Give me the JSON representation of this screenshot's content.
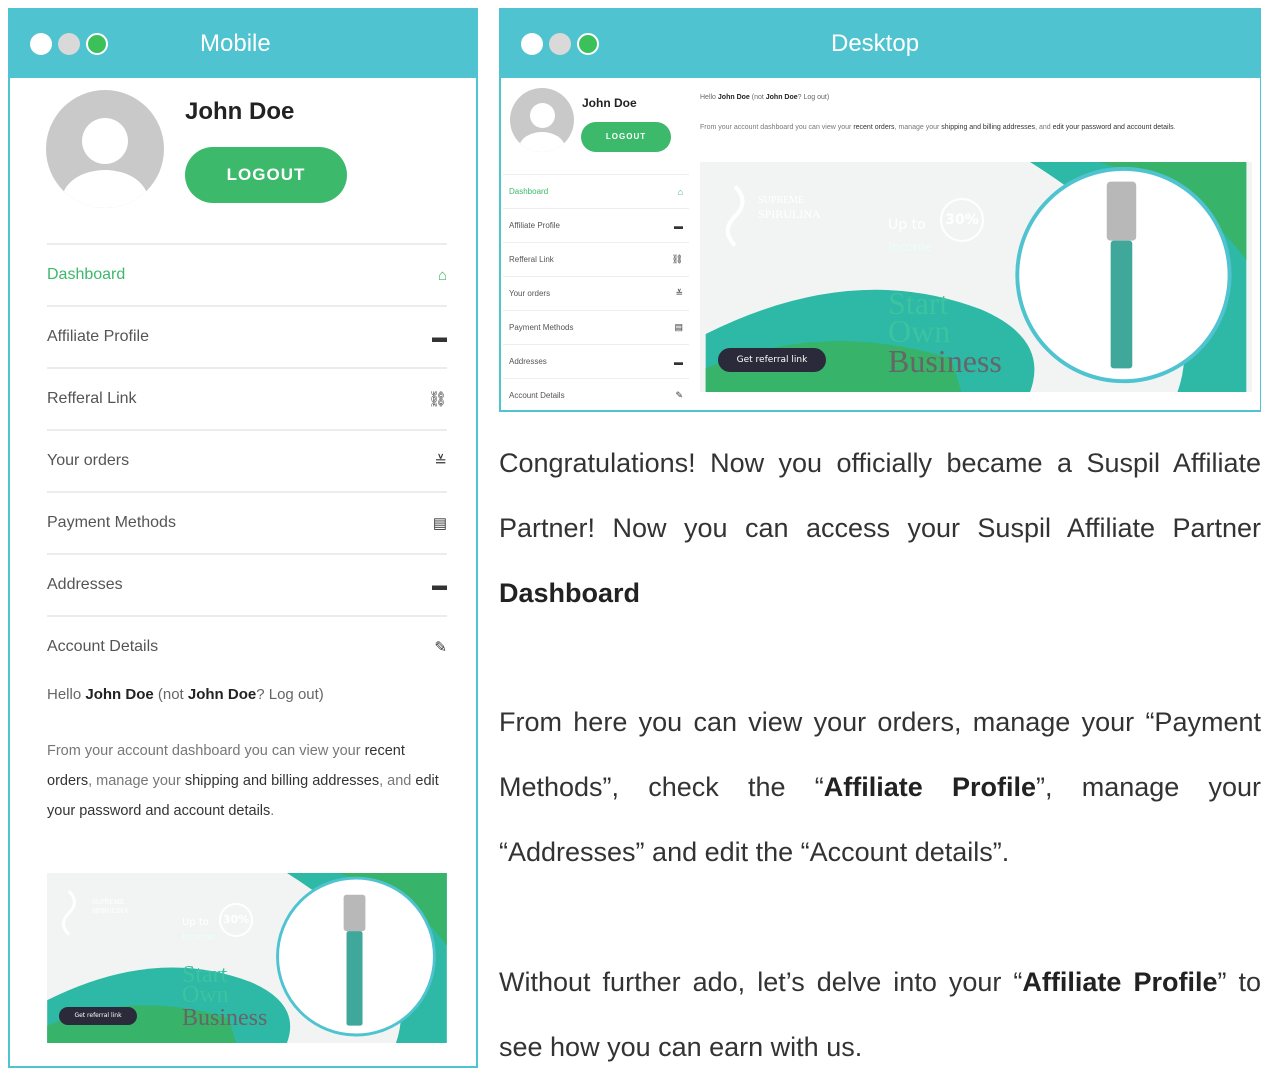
{
  "mobile": {
    "title": "Mobile",
    "user_name": "John Doe",
    "logout_label": "LOGOUT",
    "nav": [
      {
        "label": "Dashboard",
        "icon": "home-icon",
        "glyph": "⌂",
        "active": true
      },
      {
        "label": "Affiliate Profile",
        "icon": "id-card-icon",
        "glyph": "▬",
        "active": false
      },
      {
        "label": "Refferal Link",
        "icon": "link-icon",
        "glyph": "⛓",
        "active": false
      },
      {
        "label": "Your orders",
        "icon": "orders-icon",
        "glyph": "≚",
        "active": false
      },
      {
        "label": "Payment Methods",
        "icon": "credit-card-icon",
        "glyph": "▤",
        "active": false
      },
      {
        "label": "Addresses",
        "icon": "address-card-icon",
        "glyph": "▬",
        "active": false
      },
      {
        "label": "Account Details",
        "icon": "edit-icon",
        "glyph": "✎",
        "active": false
      }
    ],
    "hello": {
      "prefix": "Hello ",
      "name": "John Doe",
      "middle": " (not ",
      "name2": "John Doe",
      "suffix": "? Log out)"
    },
    "info": {
      "t1": "From your account dashboard you can view your ",
      "b1": "recent orders",
      "t2": ", manage your ",
      "b2": "shipping and billing addresses",
      "t3": ", and ",
      "b3": "edit your password and account details",
      "t4": "."
    }
  },
  "desktop": {
    "title": "Desktop",
    "user_name": "John Doe",
    "logout_label": "LOGOUT",
    "hello": {
      "prefix": "Hello ",
      "name": "John Doe",
      "middle": " (not ",
      "name2": "John Doe",
      "suffix": "? Log out)"
    },
    "info": {
      "t1": "From your account dashboard you can view your ",
      "b1": "recent orders",
      "t2": ", manage your ",
      "b2": "shipping and billing addresses",
      "t3": ", and ",
      "b3": "edit your password and account details",
      "t4": "."
    }
  },
  "banner": {
    "brand_line1": "SUPREME",
    "brand_line2": "SPIRULINA",
    "up_to": "Up to",
    "percent": "30%",
    "income": "Income",
    "start": "Start",
    "own": "Own",
    "business": "Business",
    "cta": "Get referral link"
  },
  "content": {
    "p1_text": "Congratulations! Now you officially became a Suspil Affiliate Partner! Now you can access your Suspil Affiliate Partner ",
    "p1_bold": "Dashboard",
    "p2_a": "From here you can view your orders, manage your “Payment Methods”, check the “",
    "p2_b1": "Affiliate Profile",
    "p2_c": "”, manage your “Addresses” and edit the “Account details”.",
    "p3_a": "Without further ado, let’s delve into your “",
    "p3_b": "Affiliate Profile",
    "p3_c": "” to see how you can earn with us."
  },
  "colors": {
    "accent": "#4fc3cf",
    "green": "#3cb96a",
    "teal": "#2eb8a6"
  }
}
